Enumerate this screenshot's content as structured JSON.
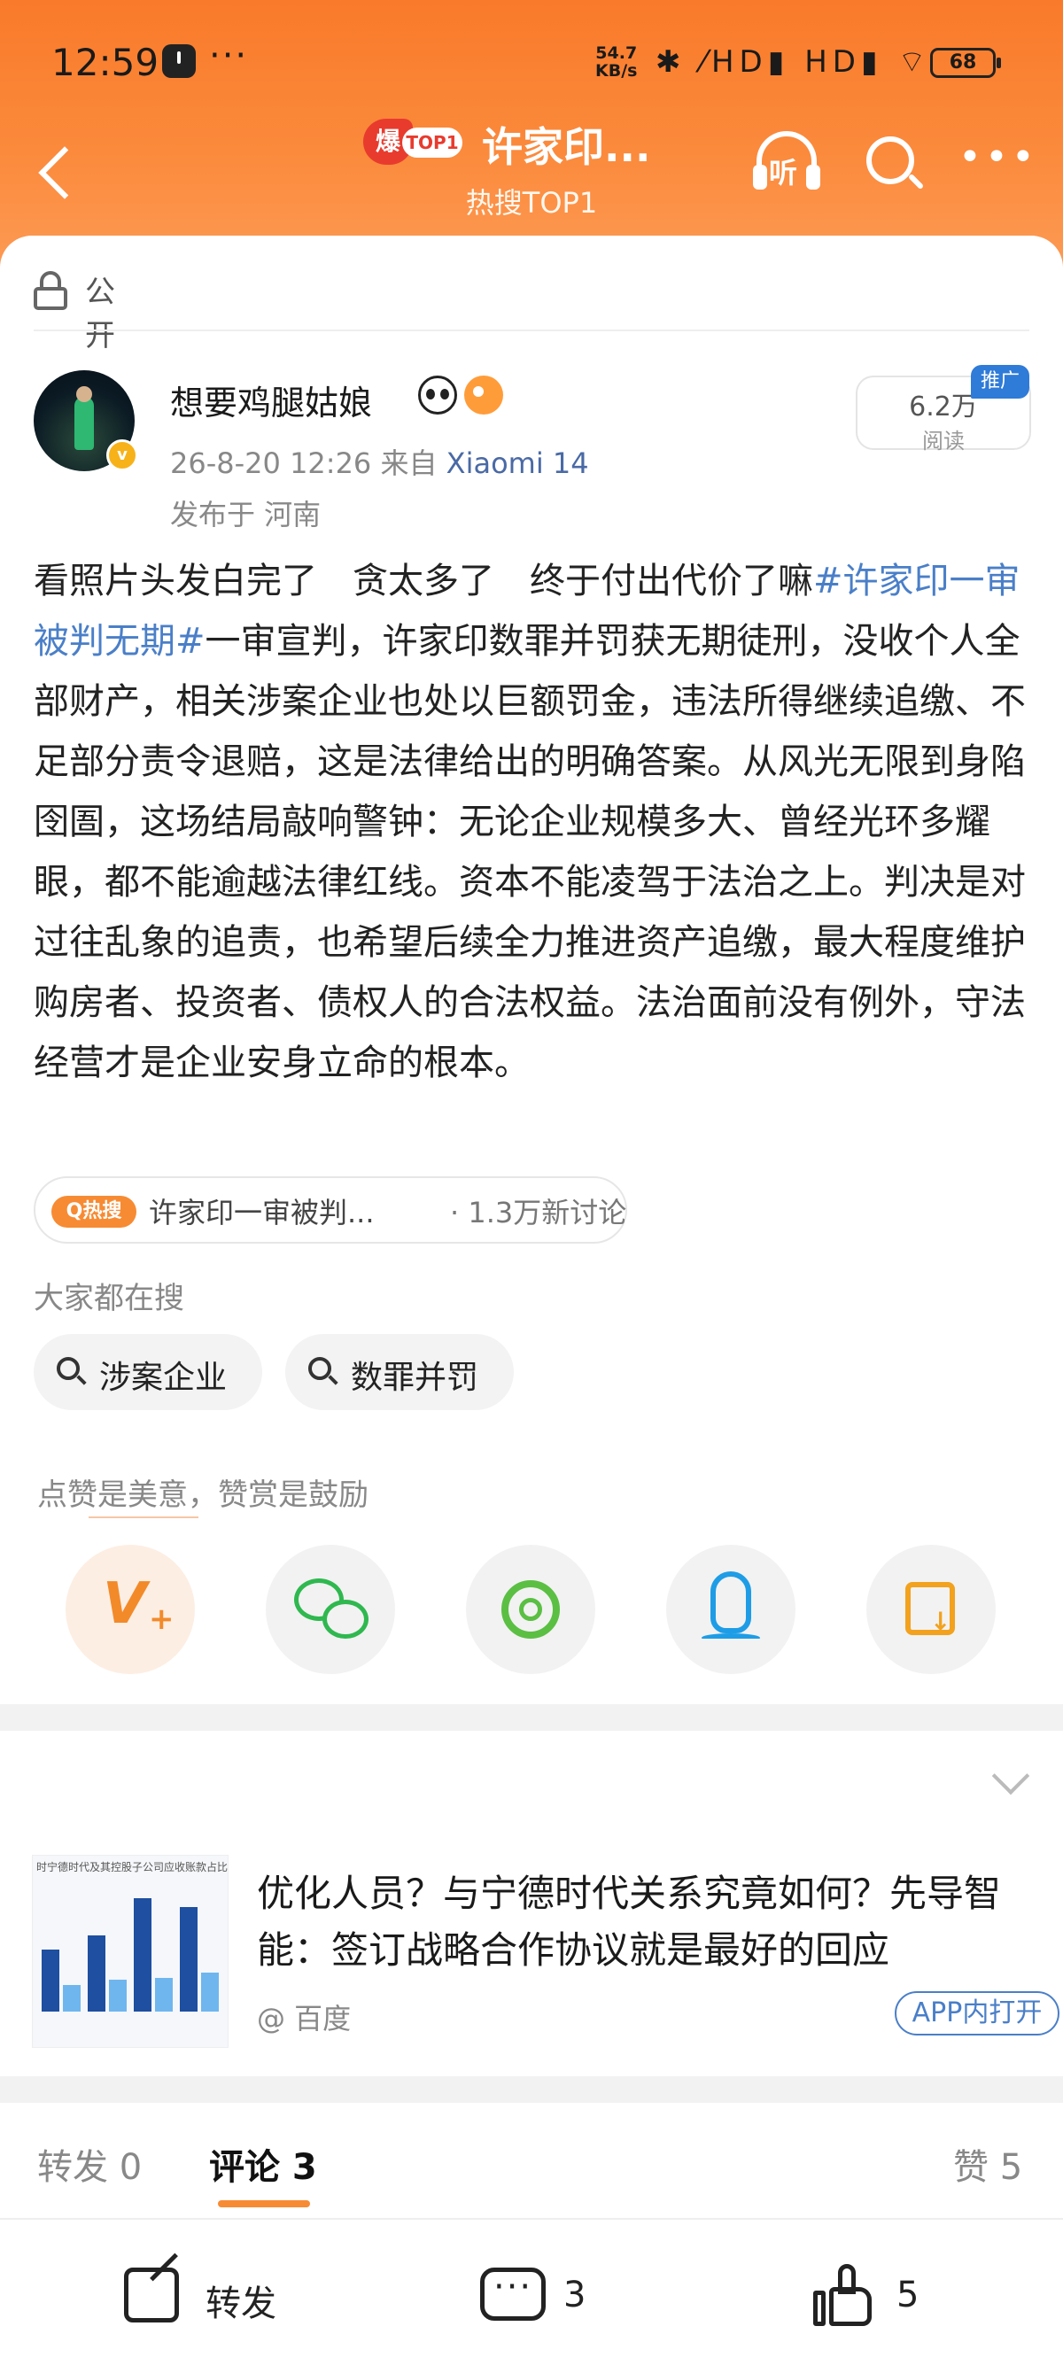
{
  "status": {
    "time": "12:59",
    "dots": "···",
    "speed_value": "54.7",
    "speed_unit": "KB/s",
    "icons": "✱ ⁄HD▮ HD▮ ⌔",
    "battery": "68"
  },
  "nav": {
    "badge_bao": "爆",
    "badge_top": "TOP1",
    "title": "许家印...",
    "subtitle": "热搜TOP1",
    "listen_label": "听"
  },
  "visibility": "公开",
  "post": {
    "author": "想要鸡腿姑娘",
    "vbadge": "v",
    "meta_date": "26-8-20 12:26",
    "meta_from": "来自",
    "meta_source": "Xiaomi 14",
    "location": "发布于 河南",
    "reads_value": "6.2万",
    "reads_label": "阅读",
    "promo": "推广",
    "text_before": "看照片头发白完了　贪太多了　终于付出代价了嘛",
    "hashtag": "#许家印一审被判无期#",
    "text_after": "一审宣判，许家印数罪并罚获无期徒刑，没收个人全部财产，相关涉案企业也处以巨额罚金，违法所得继续追缴、不足部分责令退赔，这是法律给出的明确答案。从风光无限到身陷囹圄，这场结局敲响警钟：无论企业规模多大、曾经光环多耀眼，都不能逾越法律红线。资本不能凌驾于法治之上。判决是对过往乱象的追责，也希望后续全力推进资产追缴，最大程度维护购房者、投资者、债权人的合法权益。法治面前没有例外，守法经营才是企业安身立命的根本。"
  },
  "hot": {
    "pill": "Q热搜",
    "topic": "许家印一审被判...",
    "discussion": "· 1.3万新讨论"
  },
  "search": {
    "label": "大家都在搜",
    "chips": [
      "涉案企业",
      "数罪并罚"
    ]
  },
  "praise": {
    "label": "点赞是美意，赞赏是鼓励",
    "v_icon": "V",
    "v_plus": "+"
  },
  "ad": {
    "image_caption": "时宁德时代及其控股子公司应收账款占比下降",
    "title": "优化人员？与宁德时代关系究竟如何？先导智能：签订战略合作协议就是最好的回应",
    "source": "@ 百度",
    "open_label": "APP内打开"
  },
  "tabs": {
    "forward": "转发 0",
    "comment": "评论 3",
    "like": "赞 5"
  },
  "bottom": {
    "forward_label": "转发",
    "comment_count": "3",
    "like_count": "5"
  },
  "colors": {
    "header_orange": "#f97a2a",
    "link_blue": "#4a7fc8",
    "accent_orange": "#f78b33"
  }
}
